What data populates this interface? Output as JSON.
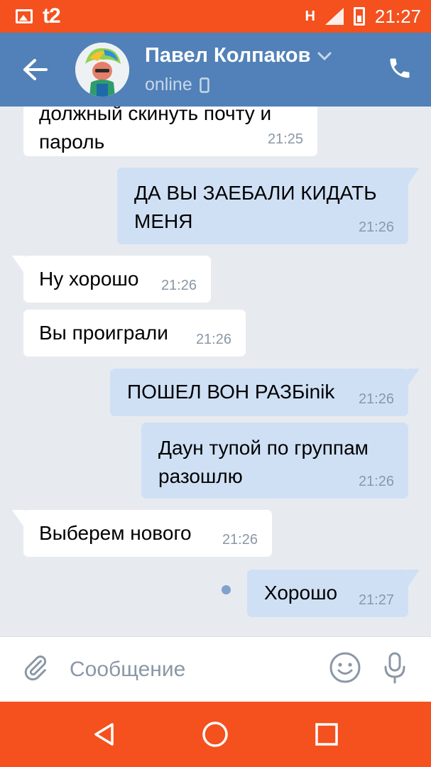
{
  "status_bar": {
    "carrier": "t2",
    "network": "H",
    "time": "21:27"
  },
  "header": {
    "contact_name": "Павел Колпаков",
    "status": "online",
    "colors": {
      "bg": "#5181b8"
    }
  },
  "messages": [
    {
      "direction": "in",
      "text_line1": "должный скинуть почту и",
      "text_line2": "пароль",
      "time": "21:25"
    },
    {
      "direction": "out",
      "text_line1": "ДА ВЫ ЗАЕБАЛИ КИДАТЬ",
      "text_line2": "МЕНЯ",
      "time": "21:26"
    },
    {
      "direction": "in",
      "text": "Ну хорошо",
      "time": "21:26"
    },
    {
      "direction": "in",
      "text": "Вы проиграли",
      "time": "21:26"
    },
    {
      "direction": "out",
      "text": "ПОШЕЛ ВОН РАЗБinik",
      "time": "21:26"
    },
    {
      "direction": "out",
      "text_line1": "Даун тупой по группам",
      "text_line2": "разошлю",
      "time": "21:26"
    },
    {
      "direction": "in",
      "text": "Выберем нового",
      "time": "21:26"
    },
    {
      "direction": "out",
      "text": "Хорошо",
      "time": "21:27",
      "unread": true
    }
  ],
  "input": {
    "placeholder": "Сообщение"
  },
  "icons": {
    "back": "arrow-left-icon",
    "call": "phone-icon",
    "attach": "paperclip-icon",
    "emoji": "smiley-icon",
    "voice": "microphone-icon"
  },
  "colors": {
    "status_nav": "#f4511e",
    "incoming_bubble": "#ffffff",
    "outgoing_bubble": "#cfe0f5",
    "chat_bg": "#e7ebf0"
  }
}
